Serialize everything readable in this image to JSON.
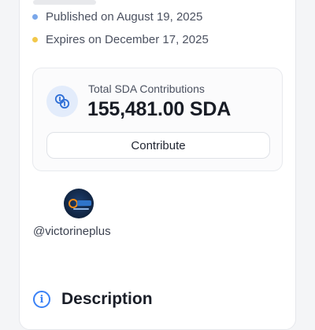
{
  "dates": {
    "published": {
      "text": "Published on August 19, 2025",
      "dot_color": "#7aa7ea"
    },
    "expires": {
      "text": "Expires on December 17, 2025",
      "dot_color": "#f2c84b"
    }
  },
  "contributions": {
    "icon": "coins-icon",
    "label": "Total SDA Contributions",
    "amount": "155,481.00 SDA",
    "button_label": "Contribute"
  },
  "creator": {
    "avatar_icon": "creator-logo-avatar",
    "username": "@victorineplus"
  },
  "description": {
    "icon": "info-icon",
    "title": "Description"
  },
  "colors": {
    "accent": "#3b82f6",
    "badge_bg": "#e3ecfb"
  }
}
